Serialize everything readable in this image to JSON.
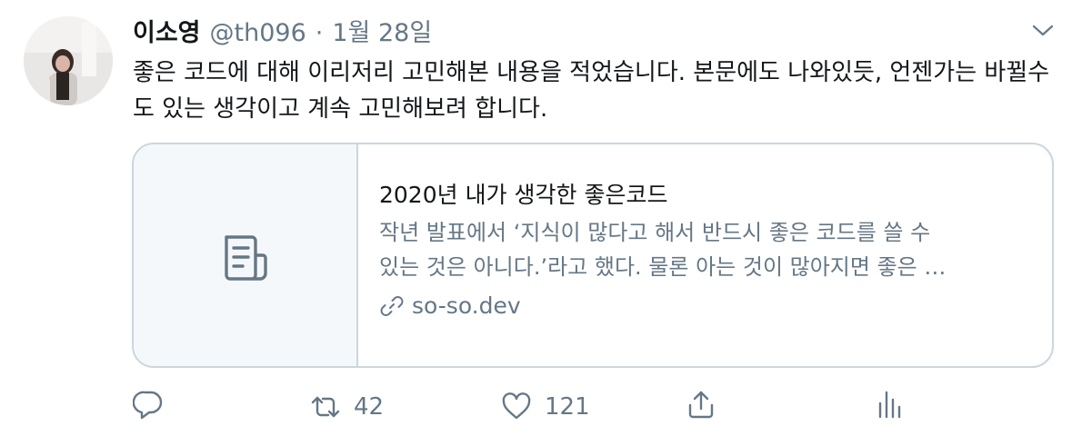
{
  "tweet": {
    "author_name": "이소영",
    "handle": "@th096",
    "separator": "·",
    "date": "1월 28일",
    "text": "좋은 코드에 대해 이리저리 고민해본 내용을 적었습니다. 본문에도 나와있듯, 언젠가는 바뀔수도 있는 생각이고 계속 고민해보려 합니다."
  },
  "card": {
    "title": "2020년 내가 생각한 좋은코드",
    "description_line1": "작년 발표에서 ‘지식이 많다고 해서 반드시 좋은 코드를 쓸 수",
    "description_line2": "있는 것은 아니다.’라고 했다. 물론 아는 것이 많아지면 좋은 …",
    "domain": "so-so.dev"
  },
  "actions": {
    "retweet_count": "42",
    "like_count": "121"
  },
  "icons": {
    "avatar": "avatar-photo",
    "caret": "chevron-down-icon",
    "card_thumb": "document-icon",
    "link": "link-icon",
    "reply": "reply-icon",
    "retweet": "retweet-icon",
    "like": "heart-icon",
    "share": "share-icon",
    "stats": "analytics-icon"
  },
  "colors": {
    "text_primary": "#14171a",
    "text_secondary": "#657786",
    "border": "#ccd6dd",
    "thumb_bg": "#f5f8fa"
  }
}
